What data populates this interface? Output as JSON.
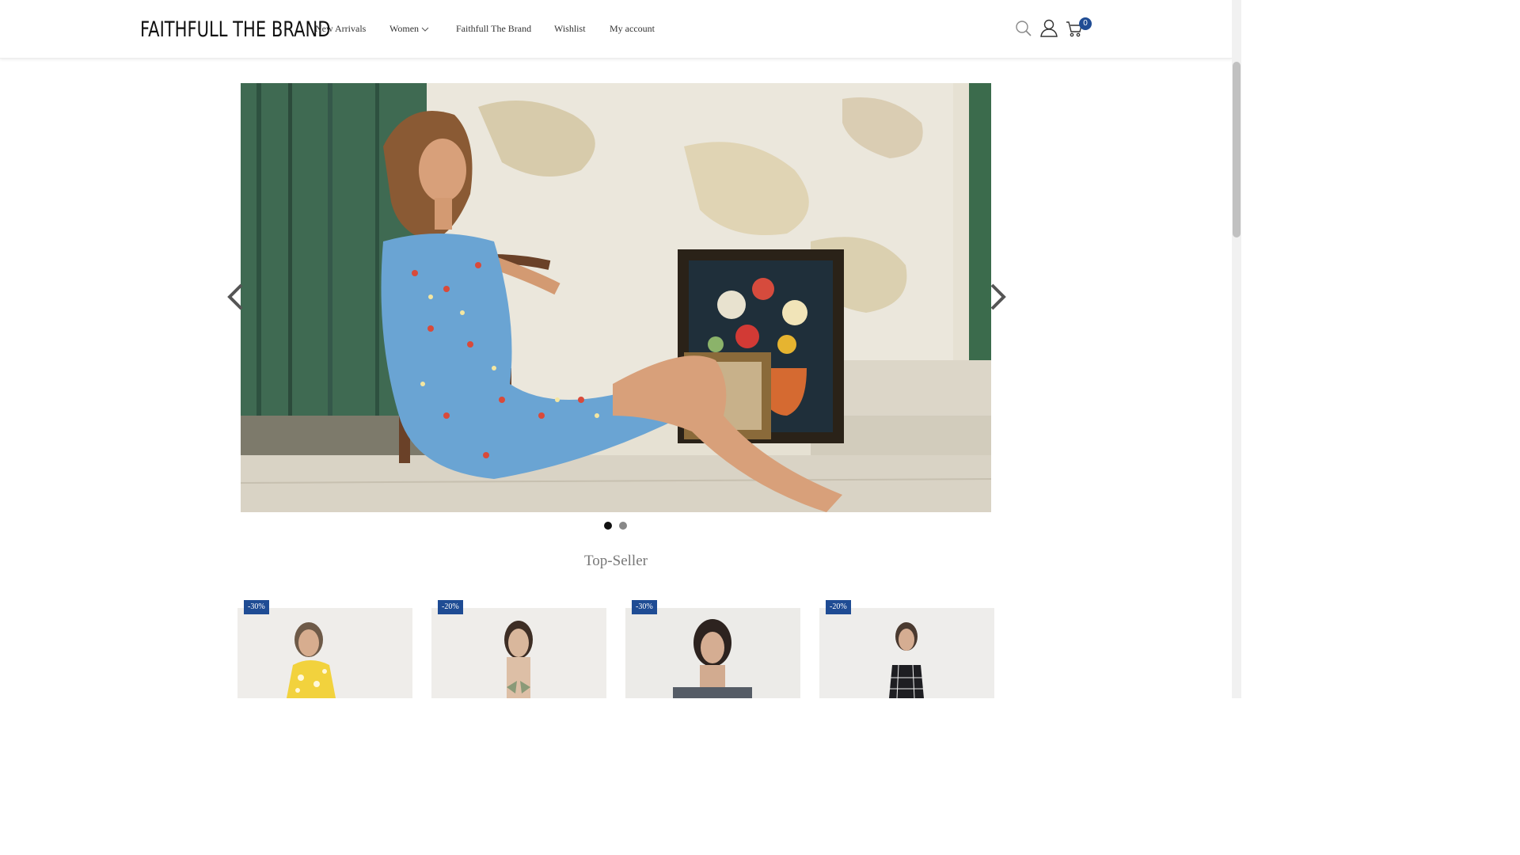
{
  "header": {
    "logo_text": "FAITHFULL THE BRAND",
    "nav": [
      {
        "label": "New Arrivals"
      },
      {
        "label": "Women"
      },
      {
        "label": "Faithfull The Brand"
      },
      {
        "label": "Wishlist"
      },
      {
        "label": "My account"
      }
    ],
    "icons": [
      "search-icon",
      "user-icon",
      "cart-icon"
    ],
    "cart_count": "0"
  },
  "slider": {
    "slides_total": 2,
    "active_slide": 1
  },
  "section": {
    "title": "Top-Seller"
  },
  "products": [
    {
      "discount": "-30%"
    },
    {
      "discount": "-20%"
    },
    {
      "discount": "-30%"
    },
    {
      "discount": "-20%"
    }
  ],
  "colors": {
    "accent": "#1f4c94",
    "text": "#333333",
    "section_title": "#777777"
  }
}
